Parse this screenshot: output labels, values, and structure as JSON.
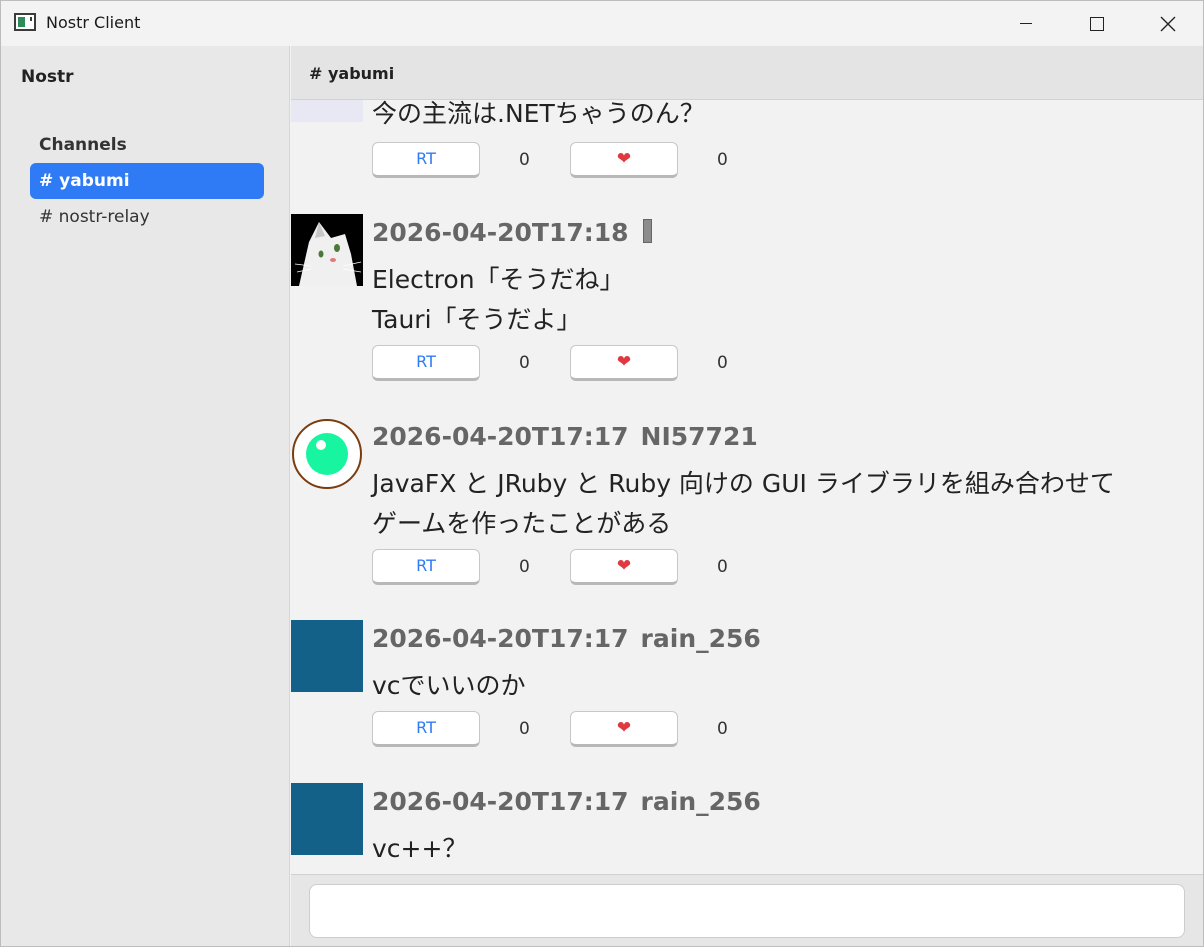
{
  "window": {
    "title": "Nostr Client"
  },
  "sidebar": {
    "brand": "Nostr",
    "heading": "Channels",
    "items": [
      {
        "label": "# yabumi",
        "active": true
      },
      {
        "label": "# nostr-relay",
        "active": false
      }
    ]
  },
  "header": {
    "channel": "# yabumi"
  },
  "feed": {
    "posts": [
      {
        "timestamp": "",
        "author": "",
        "lines": [
          "今の主流は.NETちゃうのん？"
        ],
        "rt_label": "RT",
        "rt_count": "0",
        "like_count": "0",
        "avatar": "blue-chevron-avatar"
      },
      {
        "timestamp": "2026-04-20T17:18",
        "author": "",
        "lines": [
          "Electron「そうだね」",
          "Tauri「そうだよ」"
        ],
        "rt_label": "RT",
        "rt_count": "0",
        "like_count": "0",
        "avatar": "cat-avatar"
      },
      {
        "timestamp": "2026-04-20T17:17",
        "author": "NI57721",
        "lines": [
          "JavaFX と JRuby と Ruby 向けの GUI ライブラリを組み合わせて",
          "ゲームを作ったことがある"
        ],
        "rt_label": "RT",
        "rt_count": "0",
        "like_count": "0",
        "avatar": "green-orb-avatar"
      },
      {
        "timestamp": "2026-04-20T17:17",
        "author": "rain_256",
        "lines": [
          "vcでいいのか"
        ],
        "rt_label": "RT",
        "rt_count": "0",
        "like_count": "0",
        "avatar": "teal-square-avatar"
      },
      {
        "timestamp": "2026-04-20T17:17",
        "author": "rain_256",
        "lines": [
          "vc++？"
        ],
        "avatar": "teal-square-avatar"
      }
    ]
  },
  "composer": {
    "placeholder": "",
    "value": ""
  },
  "colors": {
    "accent": "#2f7bf5",
    "heart": "#e0383e",
    "avatar_teal": "#136188",
    "orb_green": "#18f5a0"
  }
}
